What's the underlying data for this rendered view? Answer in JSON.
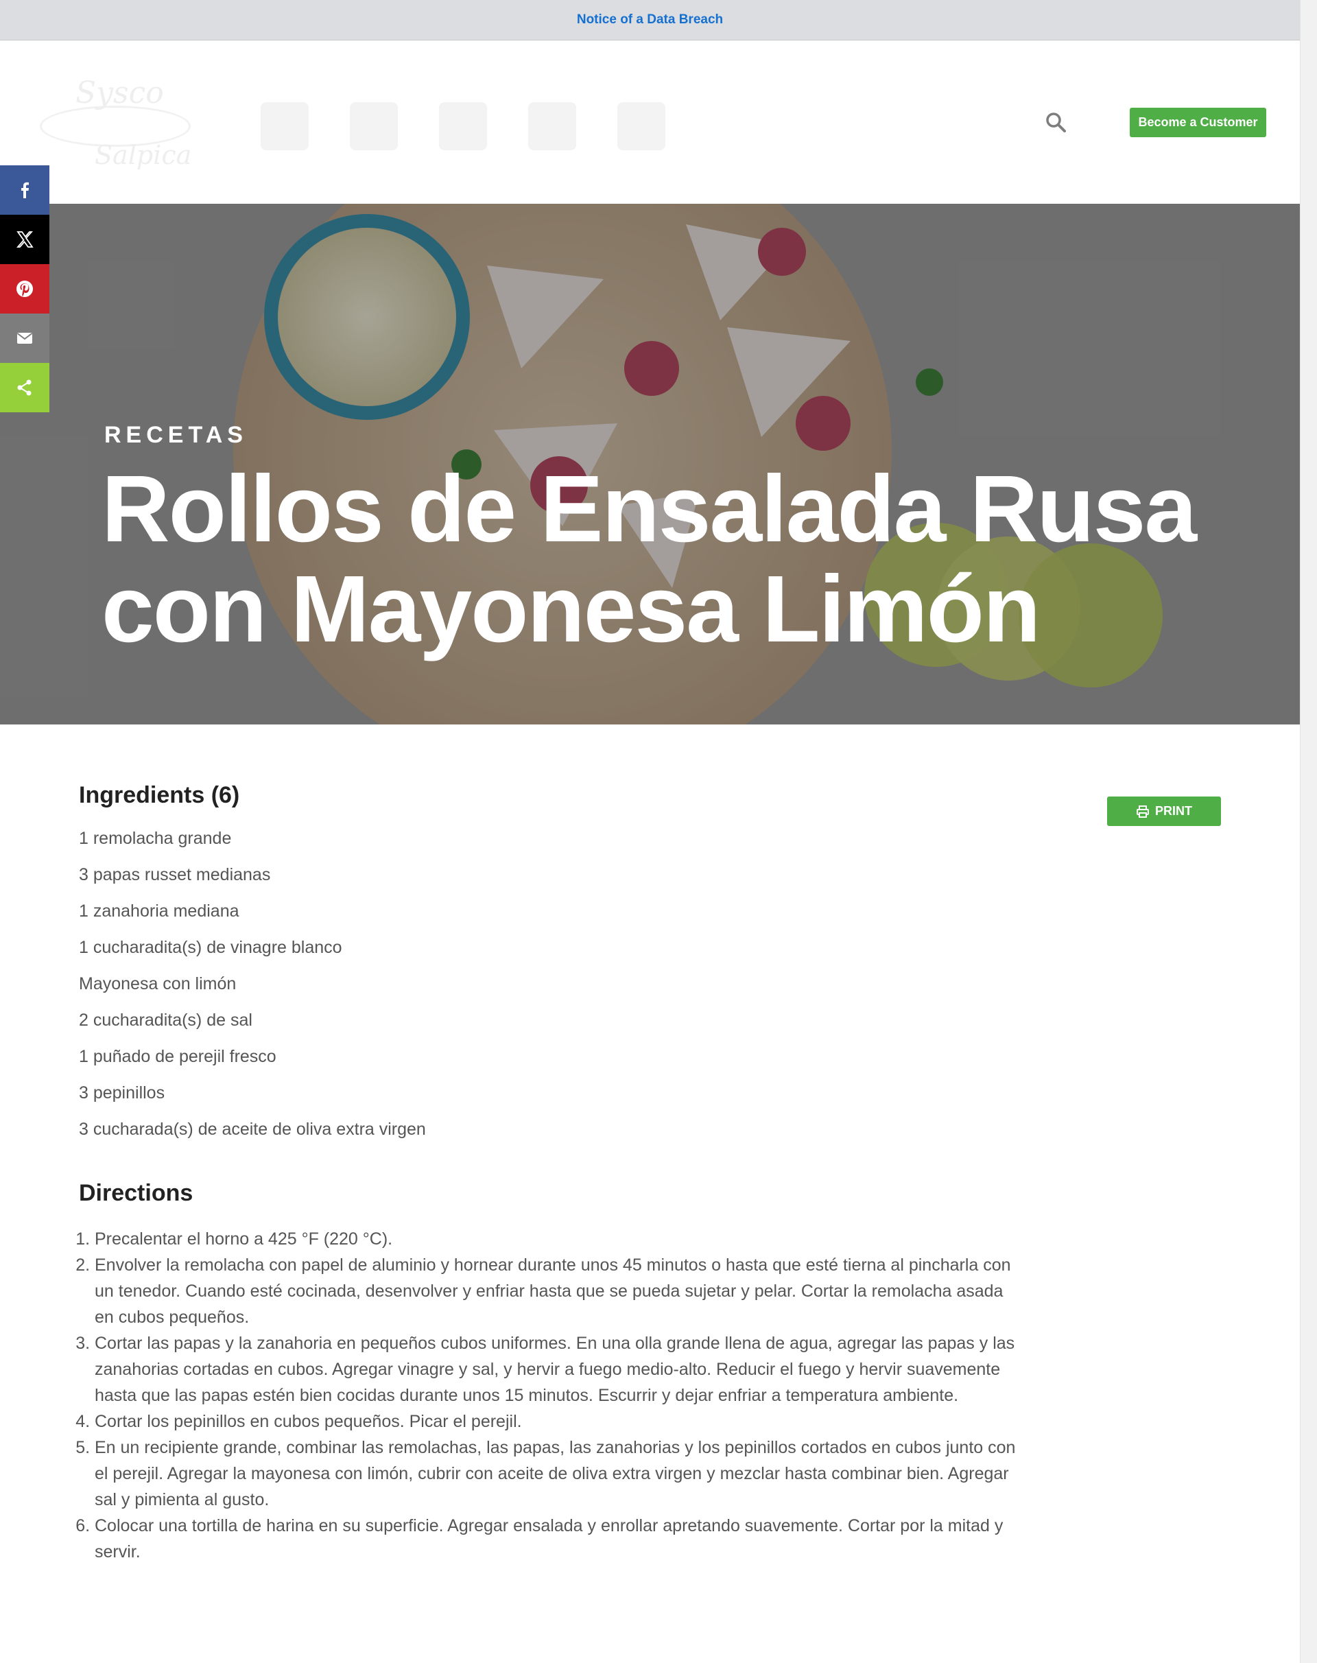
{
  "notice": {
    "link_text": "Notice of a Data Breach"
  },
  "header": {
    "logo_line1": "Sysco",
    "logo_line2": "Salpica",
    "become_customer_label": "Become a Customer",
    "icons": {
      "search": "search-icon"
    }
  },
  "share": {
    "items": [
      {
        "name": "facebook",
        "icon": "facebook-icon",
        "color": "#3b5998"
      },
      {
        "name": "x",
        "icon": "x-icon",
        "color": "#000000"
      },
      {
        "name": "pinterest",
        "icon": "pinterest-icon",
        "color": "#cb2027"
      },
      {
        "name": "email",
        "icon": "email-icon",
        "color": "#7d7d7d"
      },
      {
        "name": "share",
        "icon": "share-icon",
        "color": "#95d03a"
      }
    ]
  },
  "hero": {
    "kicker": "RECETAS",
    "title": "Rollos de Ensalada Rusa con Mayonesa Limón"
  },
  "recipe": {
    "print_label": "PRINT",
    "ingredients_title": "Ingredients (6)",
    "ingredients": [
      "1 remolacha grande",
      "3 papas russet medianas",
      "1 zanahoria mediana",
      "1 cucharadita(s) de vinagre blanco",
      "Mayonesa con limón",
      "2 cucharadita(s) de sal",
      "1 puñado de perejil fresco",
      "3 pepinillos",
      "3 cucharada(s) de aceite de oliva extra virgen"
    ],
    "directions_title": "Directions",
    "directions": [
      "Precalentar el horno a 425 °F (220 °C).",
      "Envolver la remolacha con papel de aluminio y hornear durante unos 45 minutos o hasta que esté tierna al pincharla con un tenedor. Cuando esté cocinada, desenvolver y enfriar hasta que se pueda sujetar y pelar. Cortar la remolacha asada en cubos pequeños.",
      "Cortar las papas y la zanahoria en pequeños cubos uniformes. En una olla grande llena de agua, agregar las papas y las zanahorias cortadas en cubos. Agregar vinagre y sal, y hervir a fuego medio-alto. Reducir el fuego y hervir suavemente hasta que las papas estén bien cocidas durante unos 15 minutos. Escurrir y dejar enfriar a temperatura ambiente.",
      "Cortar los pepinillos en cubos pequeños. Picar el perejil.",
      "En un recipiente grande, combinar las remolachas, las papas, las zanahorias y los pepinillos cortados en cubos junto con el perejil. Agregar la mayonesa con limón, cubrir con aceite de oliva extra virgen y mezclar hasta combinar bien. Agregar sal y pimienta al gusto.",
      "Colocar una tortilla de harina en su superficie. Agregar ensalada y enrollar apretando suavemente. Cortar por la mitad y servir."
    ]
  },
  "colors": {
    "accent_green": "#4fae46",
    "link_blue": "#1570cf"
  }
}
